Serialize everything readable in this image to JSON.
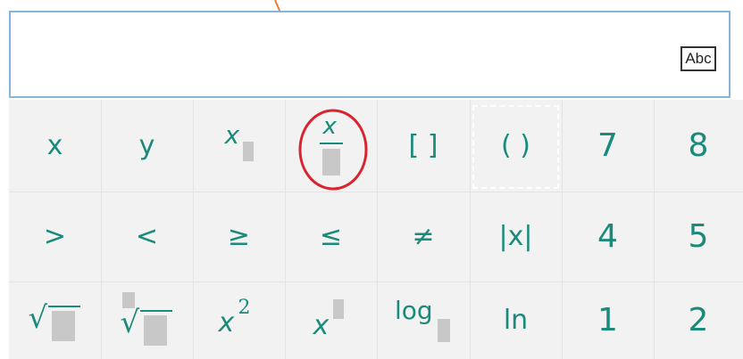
{
  "input": {
    "mode_button": "Abc"
  },
  "keys": {
    "x": "x",
    "y": "y",
    "subscript_var": "x",
    "fraction_var": "x",
    "brackets": "[ ]",
    "parens": "( )",
    "seven": "7",
    "eight": "8",
    "gt": ">",
    "lt": "<",
    "ge": "≥",
    "le": "≤",
    "ne": "≠",
    "abs": "|x|",
    "four": "4",
    "five": "5",
    "sqrt_sym": "√",
    "nthroot_sym": "√",
    "square_var": "x",
    "square_exp": "2",
    "power_var": "x",
    "log": "log",
    "ln": "ln",
    "one": "1",
    "two": "2"
  },
  "colors": {
    "accent": "#1a8a7a",
    "arrow": "#ed7d31",
    "highlight_circle": "#d9242f",
    "border": "#8ab3d9"
  }
}
